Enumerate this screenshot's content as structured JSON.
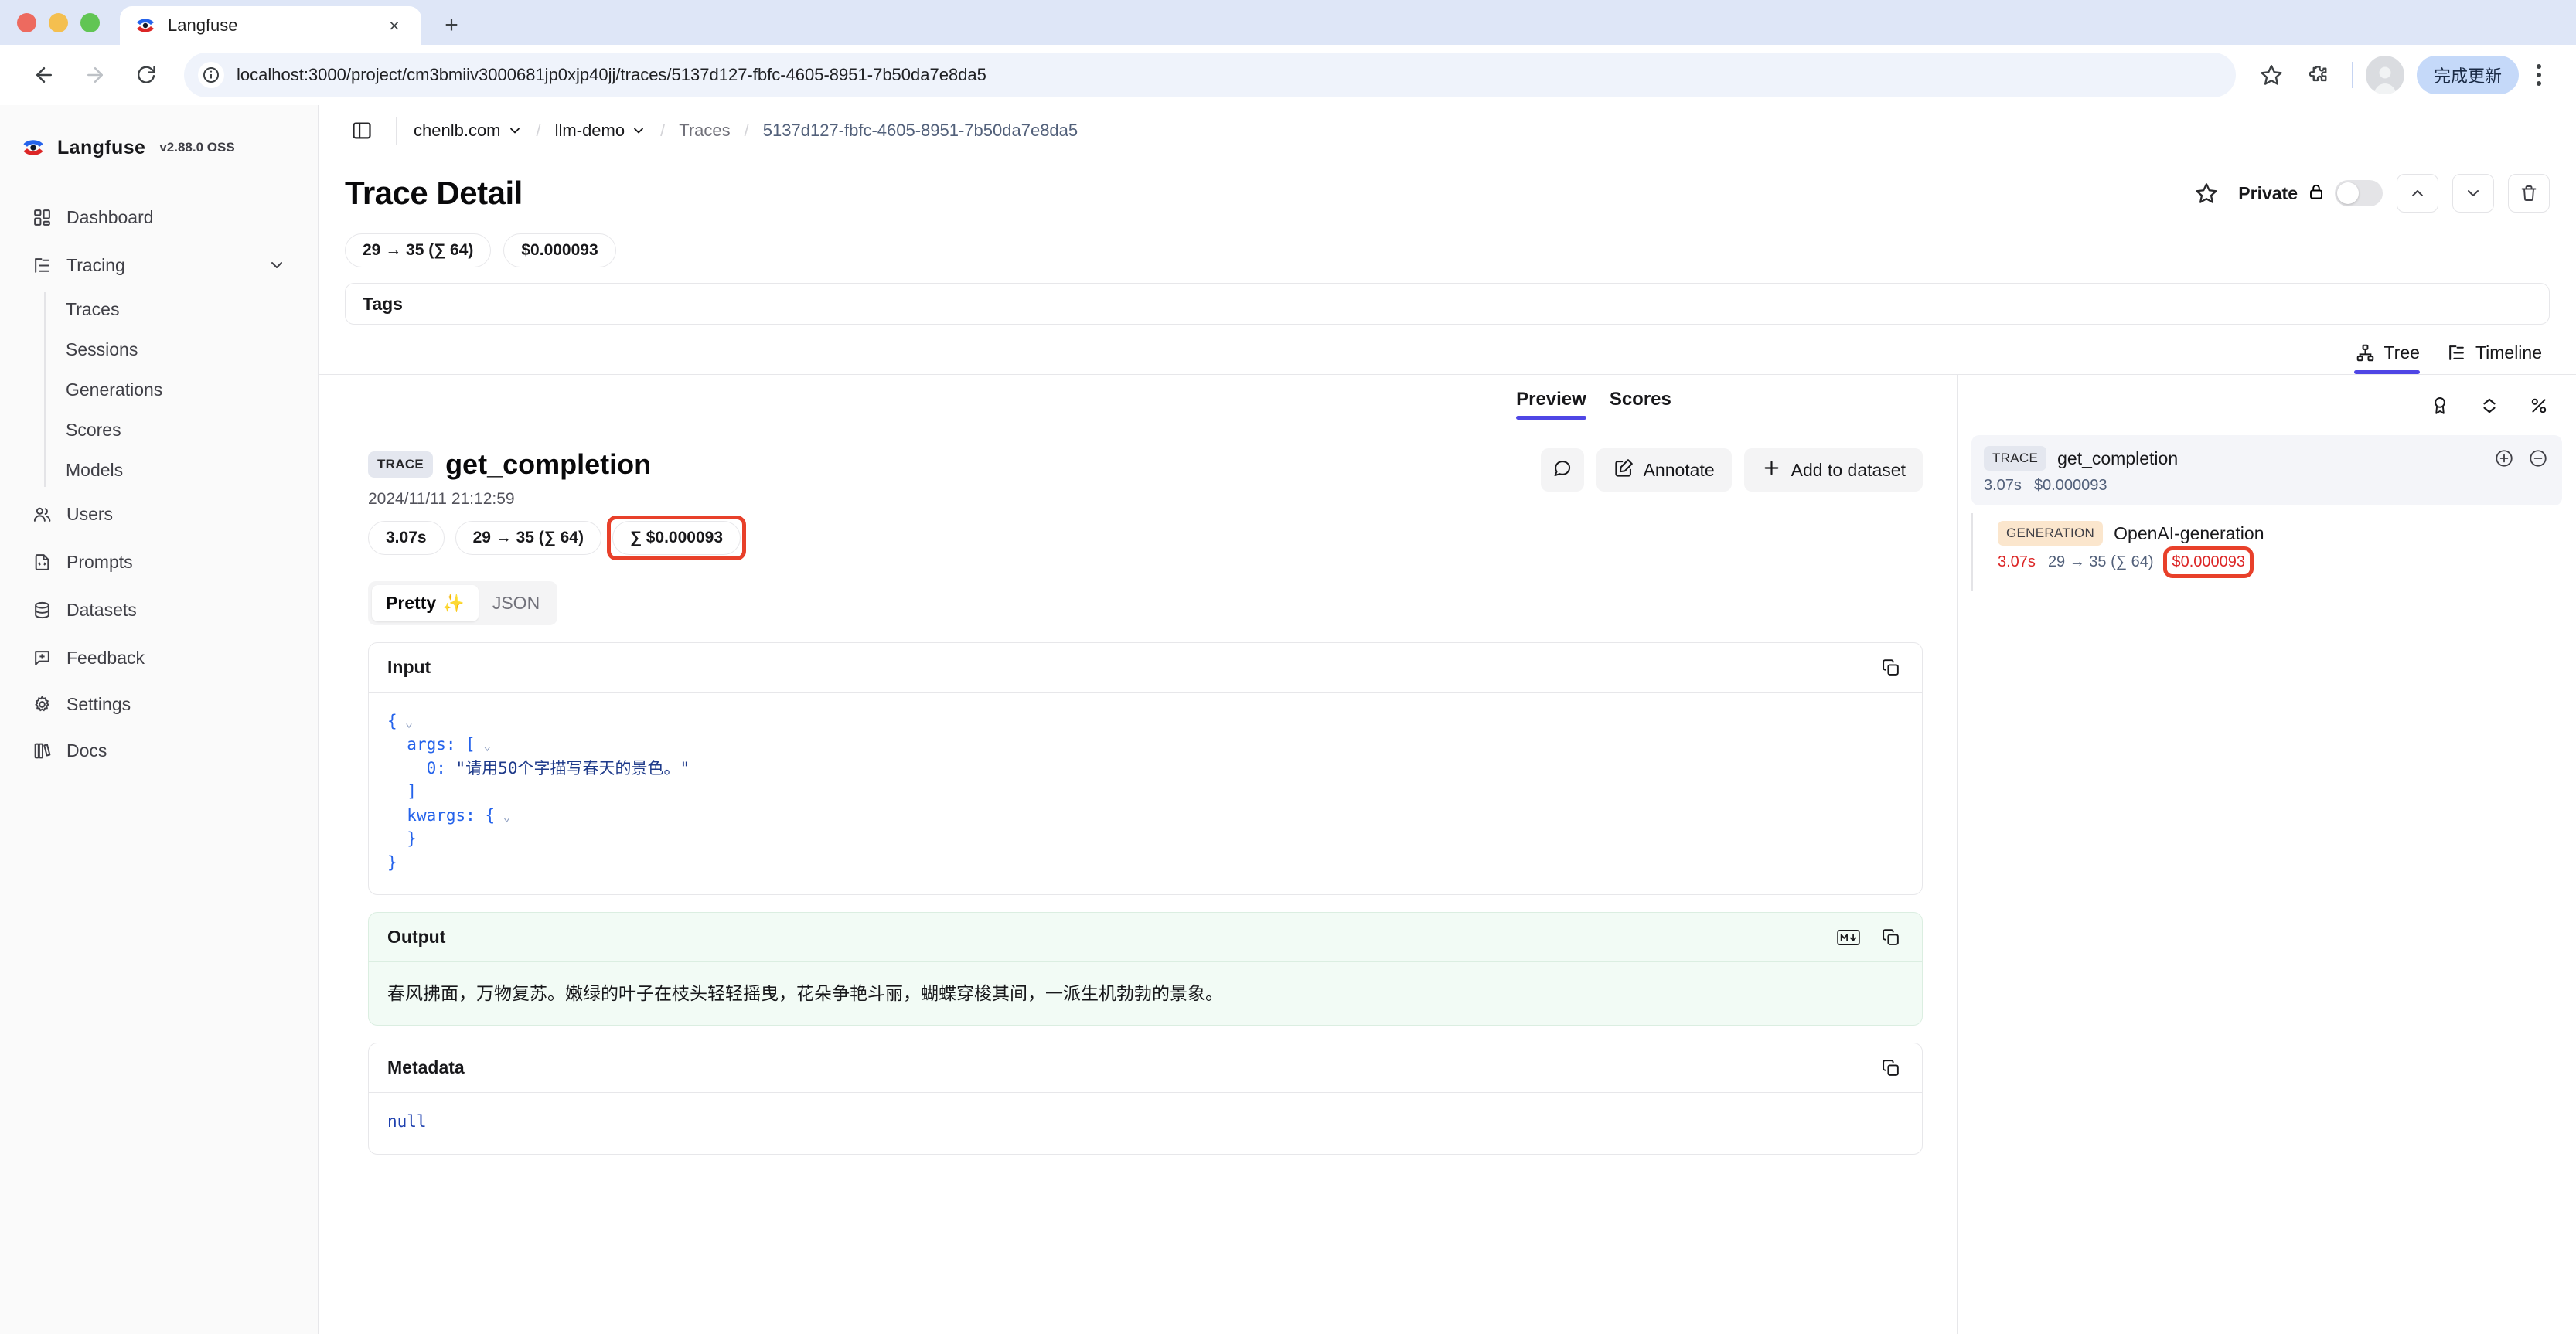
{
  "browser": {
    "tab": {
      "title": "Langfuse",
      "close_label": "×",
      "favicon": "langfuse-favicon"
    },
    "new_tab_label": "+",
    "nav": {
      "back": "←",
      "forward": "→",
      "reload": "⟳"
    },
    "omnibox": {
      "url": "localhost:3000/project/cm3bmiiv3000681jp0xjp40jj/traces/5137d127-fbfc-4605-8951-7b50da7e8da5",
      "info_icon": "site-info-icon"
    },
    "actions": {
      "bookmark_icon": "star-icon",
      "extensions_icon": "puzzle-icon",
      "profile_icon": "avatar-icon",
      "update_button": "完成更新",
      "menu_icon": "kebab-menu-icon"
    }
  },
  "sidebar": {
    "brand": {
      "name": "Langfuse",
      "version": "v2.88.0 OSS"
    },
    "items": [
      {
        "label": "Dashboard",
        "icon": "dashboard-icon"
      },
      {
        "label": "Tracing",
        "icon": "tracing-icon",
        "expanded": true
      }
    ],
    "tracing_children": [
      {
        "label": "Traces"
      },
      {
        "label": "Sessions"
      },
      {
        "label": "Generations"
      },
      {
        "label": "Scores"
      },
      {
        "label": "Models"
      }
    ],
    "items_after": [
      {
        "label": "Users",
        "icon": "users-icon"
      },
      {
        "label": "Prompts",
        "icon": "prompts-icon"
      },
      {
        "label": "Datasets",
        "icon": "datasets-icon"
      }
    ],
    "bottom_items": [
      {
        "label": "Feedback",
        "icon": "feedback-icon"
      },
      {
        "label": "Settings",
        "icon": "gear-icon"
      },
      {
        "label": "Docs",
        "icon": "book-icon"
      }
    ]
  },
  "header": {
    "panel_toggle_icon": "panel-toggle-icon",
    "breadcrumb": [
      {
        "label": "chenlb.com",
        "has_chevron": true
      },
      {
        "label": "llm-demo",
        "has_chevron": true
      },
      {
        "label": "Traces",
        "has_chevron": false
      },
      {
        "label": "5137d127-fbfc-4605-8951-7b50da7e8da5",
        "has_chevron": false
      }
    ],
    "breadcrumb_separator": "/",
    "title": "Trace Detail",
    "star_icon": "star-icon",
    "private_label": "Private",
    "lock_icon": "lock-icon",
    "toggle_state": "off",
    "prev_icon": "chevron-up-icon",
    "next_icon": "chevron-down-icon",
    "delete_icon": "trash-icon"
  },
  "trace_chips": [
    {
      "label": "29 → 35 (∑ 64)"
    },
    {
      "label": "$0.000093"
    }
  ],
  "tags": {
    "label": "Tags"
  },
  "view_tabs": [
    {
      "label": "Tree",
      "icon": "tree-icon",
      "active": true
    },
    {
      "label": "Timeline",
      "icon": "timeline-icon",
      "active": false
    }
  ],
  "pane_tabs": [
    {
      "label": "Preview",
      "active": true
    },
    {
      "label": "Scores",
      "active": false
    }
  ],
  "observation": {
    "badge": "TRACE",
    "name": "get_completion",
    "timestamp": "2024/11/11 21:12:59",
    "chips": [
      {
        "label": "3.07s",
        "highlighted": false
      },
      {
        "label": "29 → 35 (∑ 64)",
        "highlighted": false
      },
      {
        "label": "∑ $0.000093",
        "highlighted": true
      }
    ],
    "actions": [
      {
        "label": "",
        "icon": "comment-icon"
      },
      {
        "label": "Annotate",
        "icon": "pencil-square-icon"
      },
      {
        "label": "Add to dataset",
        "icon": "plus-icon"
      }
    ]
  },
  "format_toggle": {
    "options": [
      {
        "label": "Pretty",
        "suffix": "✨",
        "active": true
      },
      {
        "label": "JSON",
        "suffix": "",
        "active": false
      }
    ]
  },
  "input_card": {
    "title": "Input",
    "copy_icon": "copy-icon",
    "lines": [
      {
        "indent": 0,
        "text": "{",
        "caret": "⌄"
      },
      {
        "indent": 1,
        "text": "args: [",
        "caret": "⌄"
      },
      {
        "indent": 2,
        "text": "0: \"请用50个字描写春天的景色。\"",
        "caret": ""
      },
      {
        "indent": 1,
        "text": "]",
        "caret": ""
      },
      {
        "indent": 1,
        "text": "kwargs: {",
        "caret": "⌄"
      },
      {
        "indent": 1,
        "text": "}",
        "caret": ""
      },
      {
        "indent": 0,
        "text": "}",
        "caret": ""
      }
    ]
  },
  "output_card": {
    "title": "Output",
    "markdown_icon": "markdown-icon",
    "copy_icon": "copy-icon",
    "text": "春风拂面，万物复苏。嫩绿的叶子在枝头轻轻摇曳，花朵争艳斗丽，蝴蝶穿梭其间，一派生机勃勃的景象。"
  },
  "metadata_card": {
    "title": "Metadata",
    "copy_icon": "copy-icon",
    "value": "null"
  },
  "tree_panel": {
    "toolbar": [
      {
        "icon": "medal-icon"
      },
      {
        "icon": "collapse-icon"
      },
      {
        "icon": "percent-icon"
      }
    ],
    "root": {
      "badge": "TRACE",
      "name": "get_completion",
      "expand_icon": "plus-circle-icon",
      "collapse_icon": "minus-circle-icon",
      "stats": [
        {
          "text": "3.07s",
          "color": "normal"
        },
        {
          "text": "$0.000093",
          "color": "normal"
        }
      ]
    },
    "child": {
      "badge": "GENERATION",
      "name": "OpenAI-generation",
      "stats": [
        {
          "text": "3.07s",
          "color": "red"
        },
        {
          "text": "29 → 35 (∑ 64)",
          "color": "normal"
        }
      ],
      "cost": "$0.000093",
      "cost_highlighted": true
    }
  },
  "colors": {
    "accent": "#4f46e5",
    "highlight_red": "#e8402a",
    "red_text": "#dc2626",
    "output_bg": "#f2fbf5"
  }
}
